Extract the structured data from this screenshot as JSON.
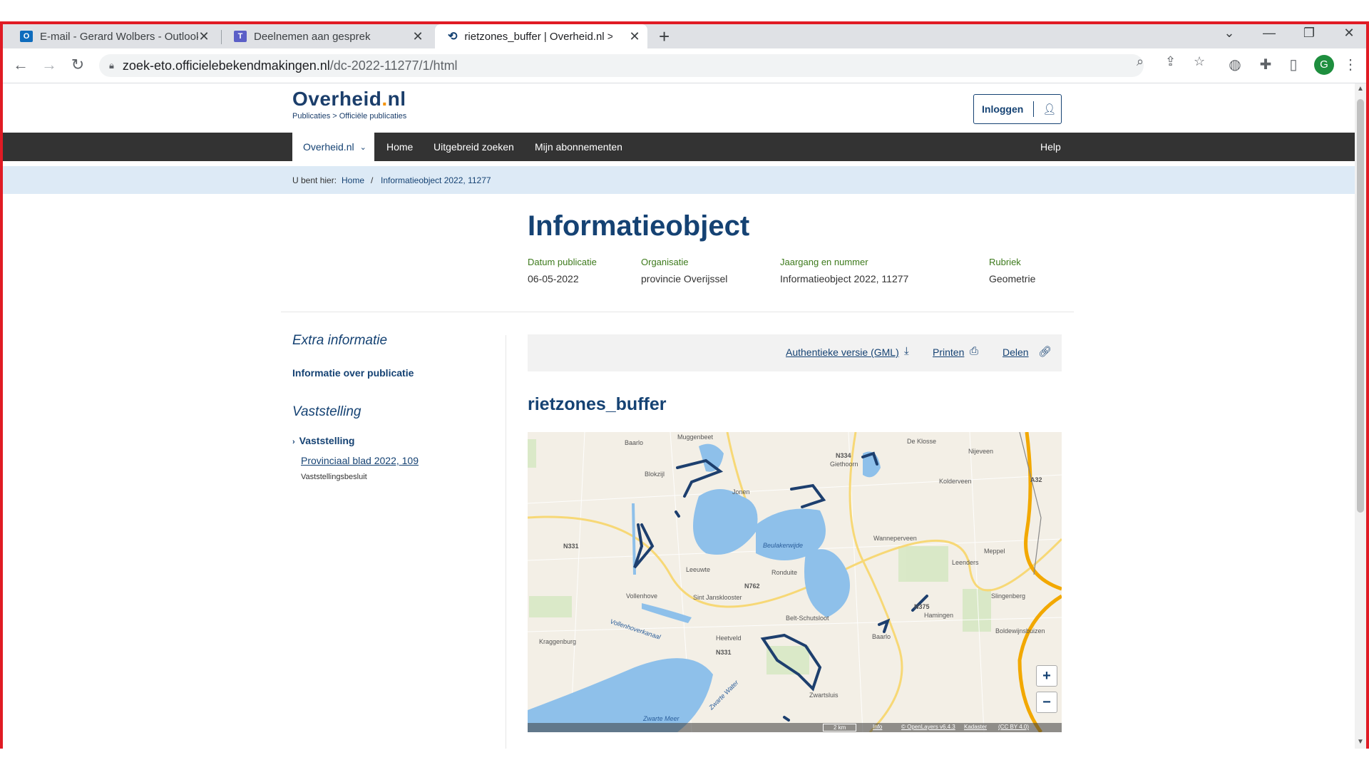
{
  "browser": {
    "tabs": [
      {
        "title": "E-mail - Gerard Wolbers - Outlook",
        "icon": "outlook-icon"
      },
      {
        "title": "Deelnemen aan gesprek",
        "icon": "teams-icon"
      },
      {
        "title": "rietzones_buffer | Overheid.nl > Officiële",
        "icon": "overheid-icon"
      }
    ],
    "url_host": "zoek-eto.officielebekendmakingen.nl",
    "url_path": "/dc-2022-11277/1/html",
    "profile_initial": "G"
  },
  "site": {
    "logo_name_a": "Overheid",
    "logo_name_dot": ".",
    "logo_name_b": "nl",
    "logo_sub": "Publicaties > Officiële publicaties",
    "login_label": "Inloggen",
    "nav": {
      "active": "Overheid.nl",
      "items": [
        "Home",
        "Uitgebreid zoeken",
        "Mijn abonnementen"
      ],
      "help": "Help"
    },
    "breadcrumb": {
      "prefix": "U bent hier:",
      "home": "Home",
      "sep": "/",
      "current": "Informatieobject 2022, 11277"
    }
  },
  "document": {
    "title": "Informatieobject",
    "meta": [
      {
        "key": "Datum publicatie",
        "value": "06-05-2022"
      },
      {
        "key": "Organisatie",
        "value": "provincie Overijssel"
      },
      {
        "key": "Jaargang en nummer",
        "value": "Informatieobject 2022, 11277"
      },
      {
        "key": "Rubriek",
        "value": "Geometrie"
      }
    ],
    "sidebar": {
      "extra_heading": "Extra informatie",
      "extra_link": "Informatie over publicatie",
      "vast_heading": "Vaststelling",
      "vast_item": "Vaststelling",
      "vast_link": "Provinciaal blad 2022, 109",
      "vast_small": "Vaststellingsbesluit"
    },
    "actions": {
      "gml": "Authentieke versie (GML)",
      "print": "Printen",
      "share": "Delen"
    },
    "object_title": "rietzones_buffer"
  },
  "map": {
    "labels": {
      "muggenbeet": "Muggenbeet",
      "baarlo": "Baarlo",
      "blokzijl": "Blokzijl",
      "jonen": "Jonen",
      "n334": "N334",
      "giethoorn": "Giethoorn",
      "deklosse": "De Klosse",
      "nijeveen": "Nijeveen",
      "kolderveen": "Kolderveen",
      "a32": "A32",
      "n331a": "N331",
      "beulakerwijde": "Beulakerwijde",
      "wanneperveen": "Wanneperveen",
      "meppel": "Meppel",
      "leeuwte": "Leeuwte",
      "ronduite": "Ronduite",
      "leenders": "Leenders",
      "n762": "N762",
      "vollenhove": "Vollenhove",
      "sintjansklooster": "Sint Jansklooster",
      "slingenberg": "Slingenberg",
      "n375": "N375",
      "beltschutsloot": "Belt-Schutsloot",
      "hamingen": "Hamingen",
      "boldewijnsbuizen": "Boldewijnsbuizen",
      "heetveld": "Heetveld",
      "n331b": "N331",
      "kraggenburg": "Kraggenburg",
      "zwartsluis": "Zwartsluis",
      "zwartemeer": "Zwarte Meer",
      "zwartewater": "Zwarte Water",
      "vollenhoverkanaal": "Vollenhoverkanaal",
      "baarlo2": "Baarlo"
    },
    "zoom_in": "+",
    "zoom_out": "−",
    "scale": "2 km",
    "attribution": {
      "info": "Info",
      "ol": "© OpenLayers v6.4.3",
      "kadaster": "Kadaster",
      "cc": "(CC BY 4.0)"
    }
  }
}
